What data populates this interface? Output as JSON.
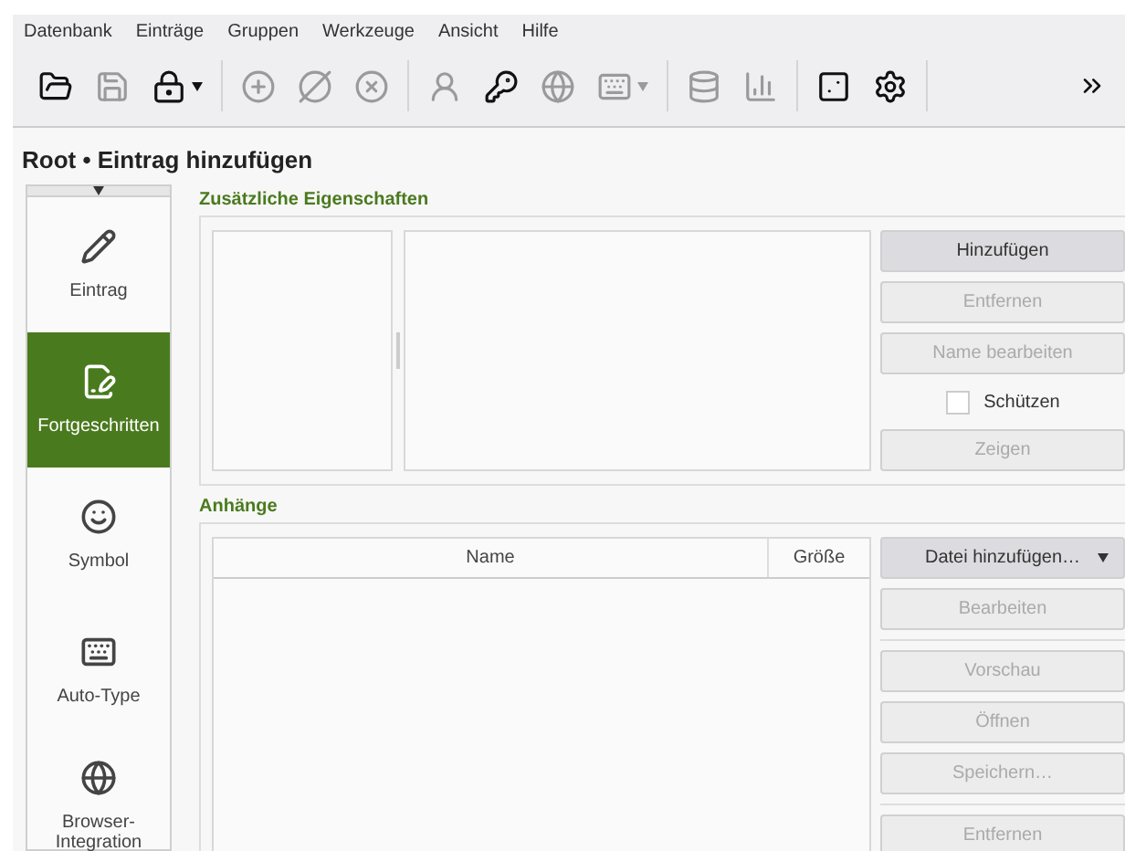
{
  "menu": [
    "Datenbank",
    "Einträge",
    "Gruppen",
    "Werkzeuge",
    "Ansicht",
    "Hilfe"
  ],
  "toolbar": [
    {
      "kind": "button",
      "disabled": false,
      "dropdown": false
    },
    {
      "kind": "button",
      "disabled": true,
      "dropdown": false
    },
    {
      "kind": "button",
      "disabled": false,
      "dropdown": true
    },
    {
      "kind": "separator"
    },
    {
      "kind": "button",
      "disabled": true,
      "dropdown": false
    },
    {
      "kind": "button",
      "disabled": true,
      "dropdown": false
    },
    {
      "kind": "button",
      "disabled": true,
      "dropdown": false
    },
    {
      "kind": "separator"
    },
    {
      "kind": "button",
      "disabled": true,
      "dropdown": false
    },
    {
      "kind": "button",
      "disabled": false,
      "dropdown": false
    },
    {
      "kind": "button",
      "disabled": true,
      "dropdown": false
    },
    {
      "kind": "button",
      "disabled": true,
      "dropdown": true
    },
    {
      "kind": "separator"
    },
    {
      "kind": "button",
      "disabled": true,
      "dropdown": false
    },
    {
      "kind": "button",
      "disabled": true,
      "dropdown": false
    },
    {
      "kind": "separator"
    },
    {
      "kind": "button",
      "disabled": false,
      "dropdown": false
    },
    {
      "kind": "button",
      "disabled": false,
      "dropdown": false
    },
    {
      "kind": "separator"
    }
  ],
  "page_title": "Root • Eintrag hinzufügen",
  "sidebar": {
    "items": [
      {
        "label": "Eintrag",
        "selected": false
      },
      {
        "label": "Fortgeschritten",
        "selected": true
      },
      {
        "label": "Symbol",
        "selected": false
      },
      {
        "label": "Auto-Type",
        "selected": false
      },
      {
        "label": "Browser-Integration",
        "selected": false
      }
    ]
  },
  "properties": {
    "title": "Zusätzliche Eigenschaften",
    "buttons": [
      {
        "kind": "button",
        "label": "Hinzufügen",
        "disabled": false
      },
      {
        "kind": "button",
        "label": "Entfernen",
        "disabled": true
      },
      {
        "kind": "button",
        "label": "Name bearbeiten",
        "disabled": true
      },
      {
        "kind": "checkbox",
        "label": "Schützen",
        "checked": false
      },
      {
        "kind": "button",
        "label": "Zeigen",
        "disabled": true
      }
    ]
  },
  "attachments": {
    "title": "Anhänge",
    "columns": [
      "Name",
      "Größe"
    ],
    "buttons": [
      {
        "kind": "dropdown",
        "label": "Datei hinzufügen…",
        "disabled": false
      },
      {
        "kind": "button",
        "label": "Bearbeiten",
        "disabled": true
      },
      {
        "kind": "separator"
      },
      {
        "kind": "button",
        "label": "Vorschau",
        "disabled": true
      },
      {
        "kind": "button",
        "label": "Öffnen",
        "disabled": true
      },
      {
        "kind": "button",
        "label": "Speichern…",
        "disabled": true
      },
      {
        "kind": "separator"
      },
      {
        "kind": "button",
        "label": "Entfernen",
        "disabled": true
      }
    ]
  }
}
